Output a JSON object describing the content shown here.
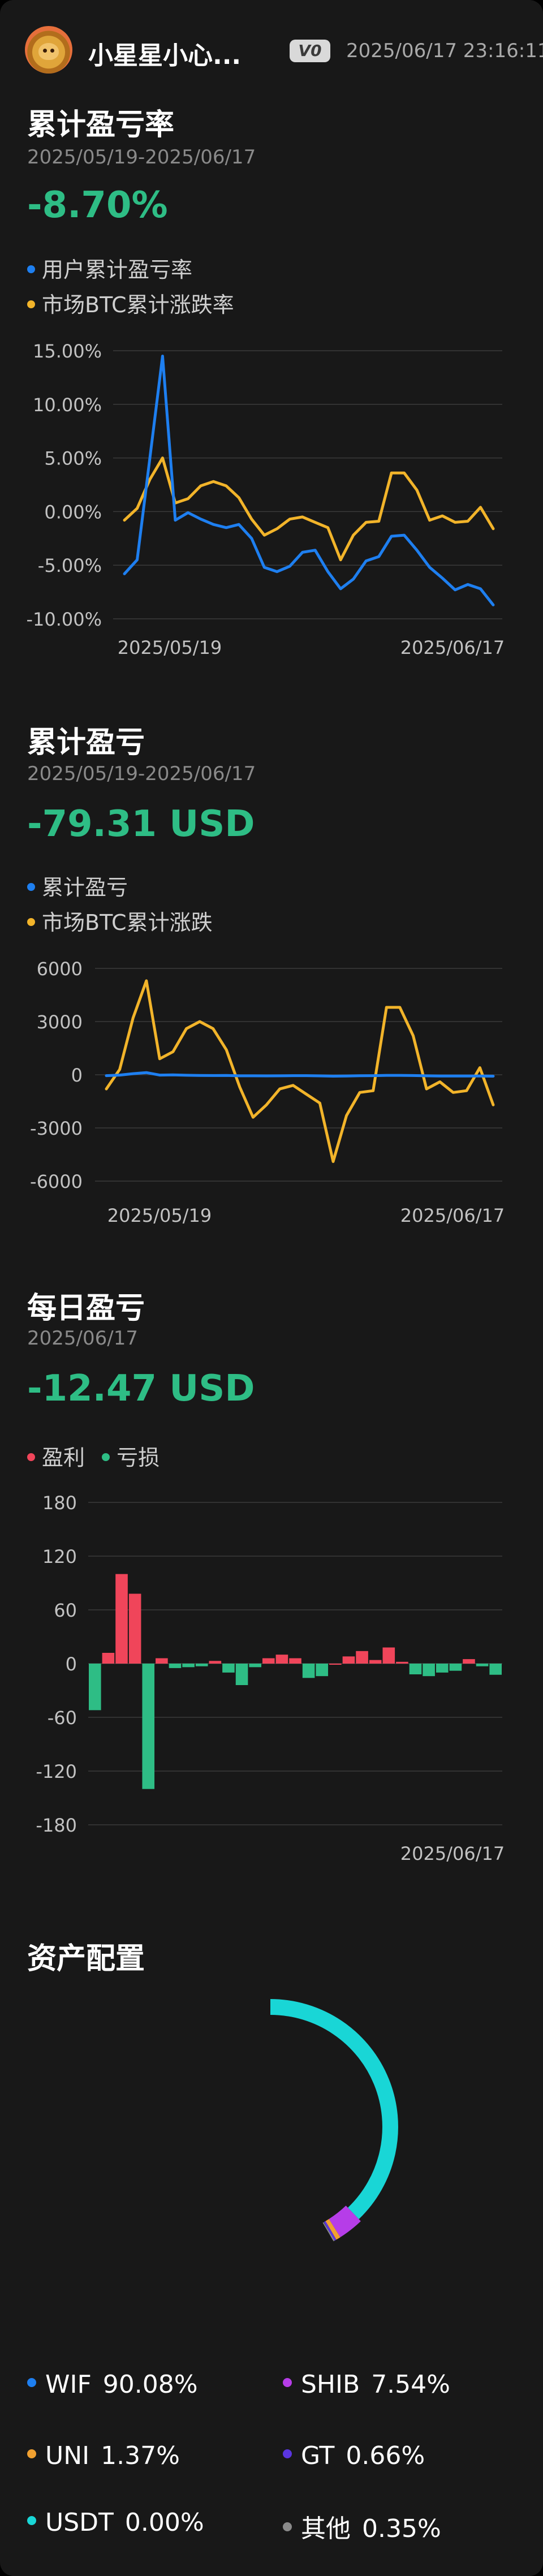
{
  "header": {
    "username": "小星星小心...",
    "vip_badge": "V0",
    "timestamp": "2025/06/17 23:16:11"
  },
  "colors": {
    "blue": "#1e7ff0",
    "yellow": "#f2b42a",
    "green": "#2ebd85",
    "red": "#f0455a",
    "grid": "#3a3a3a",
    "axis_text": "#c2c2c2"
  },
  "section_rate": {
    "title": "累计盈亏率",
    "date_range": "2025/05/19-2025/06/17",
    "value": "-8.70%",
    "legend": [
      "用户累计盈亏率",
      "市场BTC累计涨跌率"
    ]
  },
  "section_pnl": {
    "title": "累计盈亏",
    "date_range": "2025/05/19-2025/06/17",
    "value": "-79.31 USD",
    "legend": [
      "累计盈亏",
      "市场BTC累计涨跌"
    ]
  },
  "section_daily": {
    "title": "每日盈亏",
    "date": "2025/06/17",
    "value": "-12.47 USD",
    "legend": [
      "盈利",
      "亏损"
    ]
  },
  "section_alloc": {
    "title": "资产配置"
  },
  "chart_data": [
    {
      "type": "line",
      "ylim": [
        -10,
        15
      ],
      "yticks": [
        15,
        10,
        5,
        0,
        -5,
        -10
      ],
      "ytick_labels": [
        "15.00%",
        "10.00%",
        "5.00%",
        "0.00%",
        "-5.00%",
        "-10.00%"
      ],
      "xtick_labels": [
        "2025/05/19",
        "2025/06/17"
      ],
      "grid": true,
      "series": [
        {
          "name": "用户累计盈亏率",
          "color": "#1e7ff0",
          "values": [
            -5.8,
            -4.5,
            5.0,
            14.5,
            -0.8,
            -0.1,
            -0.7,
            -1.2,
            -1.5,
            -1.2,
            -2.5,
            -5.2,
            -5.6,
            -5.1,
            -3.8,
            -3.6,
            -5.6,
            -7.2,
            -6.3,
            -4.6,
            -4.2,
            -2.3,
            -2.2,
            -3.6,
            -5.2,
            -6.2,
            -7.3,
            -6.8,
            -7.2,
            -8.7
          ]
        },
        {
          "name": "市场BTC累计涨跌率",
          "color": "#f2b42a",
          "values": [
            -0.8,
            0.3,
            3.0,
            5.0,
            0.8,
            1.2,
            2.4,
            2.8,
            2.4,
            1.3,
            -0.7,
            -2.2,
            -1.6,
            -0.7,
            -0.5,
            -1.0,
            -1.5,
            -4.5,
            -2.2,
            -1.0,
            -0.9,
            3.6,
            3.6,
            2.0,
            -0.8,
            -0.4,
            -1.0,
            -0.9,
            0.4,
            -1.6
          ]
        }
      ]
    },
    {
      "type": "line",
      "ylim": [
        -6000,
        6000
      ],
      "yticks": [
        6000,
        3000,
        0,
        -3000,
        -6000
      ],
      "ytick_labels": [
        "6000",
        "3000",
        "0",
        "-3000",
        "-6000"
      ],
      "xtick_labels": [
        "2025/05/19",
        "2025/06/17"
      ],
      "grid": true,
      "series": [
        {
          "name": "累计盈亏",
          "color": "#1e7ff0",
          "values": [
            -50,
            -20,
            60,
            120,
            -20,
            -10,
            -30,
            -40,
            -45,
            -40,
            -60,
            -60,
            -65,
            -60,
            -50,
            -50,
            -65,
            -80,
            -70,
            -55,
            -50,
            -35,
            -35,
            -45,
            -60,
            -70,
            -75,
            -72,
            -75,
            -79.31
          ]
        },
        {
          "name": "市场BTC累计涨跌",
          "color": "#f2b42a",
          "values": [
            -800,
            300,
            3200,
            5300,
            900,
            1300,
            2600,
            3000,
            2600,
            1400,
            -700,
            -2400,
            -1700,
            -800,
            -600,
            -1100,
            -1600,
            -4900,
            -2300,
            -1000,
            -900,
            3800,
            3800,
            2200,
            -800,
            -400,
            -1000,
            -900,
            400,
            -1700
          ]
        }
      ]
    },
    {
      "type": "bar",
      "ylim": [
        -180,
        180
      ],
      "yticks": [
        180,
        120,
        60,
        0,
        -60,
        -120,
        -180
      ],
      "ytick_labels": [
        "180",
        "120",
        "60",
        "0",
        "-60",
        "-120",
        "-180"
      ],
      "xtick_labels": [
        "2025/06/17"
      ],
      "grid": true,
      "values": [
        -52,
        12,
        100,
        78,
        -140,
        6,
        -5,
        -4,
        -3,
        3,
        -10,
        -24,
        -4,
        6,
        10,
        6,
        -16,
        -14,
        0,
        8,
        14,
        4,
        18,
        2,
        -12,
        -14,
        -10,
        -8,
        5,
        -3,
        -12.47
      ]
    },
    {
      "type": "pie",
      "labels": [
        "WIF",
        "SHIB",
        "UNI",
        "GT",
        "USDT",
        "其他"
      ],
      "values": [
        90.08,
        7.54,
        1.37,
        0.66,
        0.0,
        0.35
      ],
      "value_labels": [
        "90.08%",
        "7.54%",
        "1.37%",
        "0.66%",
        "0.00%",
        "0.35%"
      ],
      "legend_colors": [
        "#1e7ff0",
        "#b63de8",
        "#f0a030",
        "#5a35e0",
        "#19d6d6",
        "#8a8a8a"
      ],
      "ring_colors": [
        "#19d6d6",
        "#b63de8",
        "#f0a030",
        "#5a35e0",
        "#19d6d6",
        "#8a8a8a"
      ]
    }
  ]
}
